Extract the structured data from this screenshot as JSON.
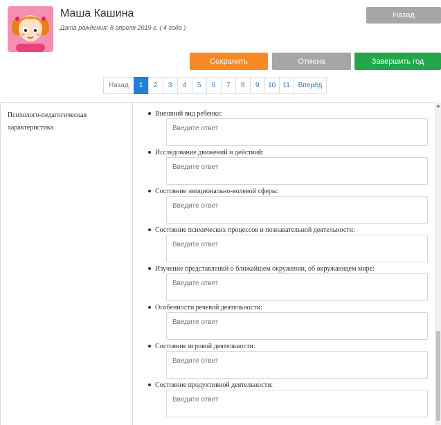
{
  "child": {
    "name": "Маша Кашина",
    "birth_info": "Дата рождения: 8 апреля 2019 г. ( 4 года )",
    "avatar_icon": "girl-avatar-icon"
  },
  "header": {
    "back_label": "Назад"
  },
  "actions": {
    "save_label": "Сохранить",
    "cancel_label": "Отмена",
    "finish_label": "Завершить год"
  },
  "pagination": {
    "prev_label": "Назад",
    "next_label": "Вперёд",
    "pages": [
      "1",
      "2",
      "3",
      "4",
      "5",
      "6",
      "7",
      "8",
      "9",
      "10",
      "11"
    ],
    "current": "1"
  },
  "section": {
    "label": "Психолого-педагогическая характеристика",
    "placeholder": "Введите ответ",
    "questions": [
      "Внешний вид ребенка:",
      "Исследование движений и действий:",
      "Состояние эмоционально-волевой сферы:",
      "Состояние психических процессов и познавательной деятельности:",
      "Изучение представлений о ближайшем окружении, об окружающем мире:",
      "Особенности речевой деятельности:",
      "Состояние игровой деятельности:",
      "Состояние продуктивной деятельности:"
    ]
  },
  "colors": {
    "save": "#f58a24",
    "cancel": "#a6a6a6",
    "finish": "#23a54b",
    "active_page": "#1f7fdb",
    "avatar_bg": "#f48fb1"
  }
}
